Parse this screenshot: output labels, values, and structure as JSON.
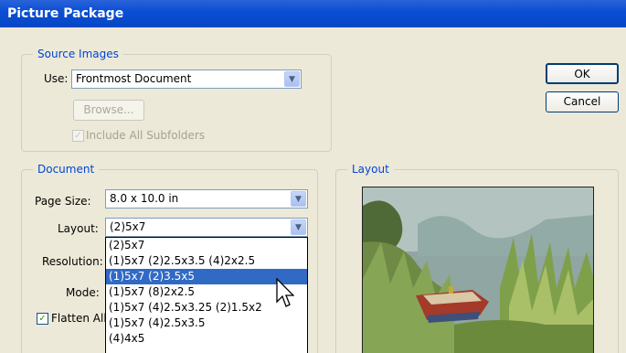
{
  "window": {
    "title": "Picture Package"
  },
  "source_images": {
    "legend": "Source Images",
    "use_label": "Use:",
    "use_value": "Frontmost Document",
    "browse_label": "Browse...",
    "include_subfolders_label": "Include All Subfolders",
    "include_subfolders_checked": true
  },
  "buttons": {
    "ok": "OK",
    "cancel": "Cancel"
  },
  "document": {
    "legend": "Document",
    "page_size_label": "Page Size:",
    "page_size_value": "8.0 x 10.0 in",
    "layout_label": "Layout:",
    "layout_value": "(2)5x7",
    "resolution_label": "Resolution:",
    "mode_label": "Mode:",
    "flatten_label": "Flatten All",
    "flatten_checked": true
  },
  "layout_options": [
    {
      "label": "(2)5x7",
      "selected": false
    },
    {
      "label": "(1)5x7 (2)2.5x3.5 (4)2x2.5",
      "selected": false
    },
    {
      "label": "(1)5x7 (2)3.5x5",
      "selected": true
    },
    {
      "label": "(1)5x7 (8)2x2.5",
      "selected": false
    },
    {
      "label": "(1)5x7 (4)2.5x3.25 (2)1.5x2",
      "selected": false
    },
    {
      "label": "(1)5x7 (4)2.5x3.5",
      "selected": false
    },
    {
      "label": "(4)4x5",
      "selected": false
    }
  ],
  "layout_panel": {
    "legend": "Layout"
  },
  "colors": {
    "title_bar": "#0a4fd4",
    "dialog_bg": "#ece9d8",
    "group_legend": "#0046d5",
    "selection": "#316ac5"
  },
  "icons": {
    "dropdown_arrow": "chevron-down-icon",
    "checkmark": "check-icon",
    "cursor": "arrow-cursor-icon"
  }
}
